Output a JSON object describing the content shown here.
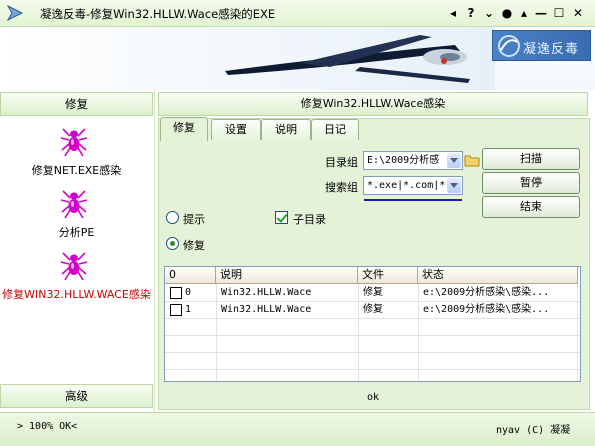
{
  "window": {
    "title": "凝逸反毒-修复Win32.HLLW.Wace感染的EXE",
    "controls": [
      "◂",
      "?",
      "⌄",
      "●",
      "▴",
      "—",
      "☐",
      "✕"
    ]
  },
  "banner": {
    "logo_text": "凝逸反毒"
  },
  "sidebar": {
    "header": "修复",
    "items": [
      {
        "label": "修复NET.EXE感染",
        "color": "#000000"
      },
      {
        "label": "分析PE",
        "color": "#000000"
      },
      {
        "label": "修复WIN32.HLLW.WACE感染",
        "color": "#cc0000"
      }
    ],
    "footer": "高级"
  },
  "main": {
    "header": "修复Win32.HLLW.Wace感染",
    "tabs": [
      "修复",
      "设置",
      "说明",
      "日记"
    ],
    "active_tab": "修复",
    "dir_label": "目录组",
    "dir_value": "E:\\2009分析感",
    "search_label": "搜索组",
    "search_value": "*.exe|*.com|*",
    "buttons": {
      "scan": "扫描",
      "pause": "暂停",
      "stop": "结束"
    },
    "options": {
      "prompt": "提示",
      "subdir": "子目录",
      "repair": "修复",
      "prompt_checked": false,
      "repair_checked": true,
      "subdir_checked": true
    },
    "table": {
      "columns": [
        "0",
        "说明",
        "文件",
        "状态"
      ],
      "rows": [
        {
          "id": "0",
          "desc": "Win32.HLLW.Wace",
          "file": "修复",
          "status": "e:\\2009分析感染\\感染..."
        },
        {
          "id": "1",
          "desc": "Win32.HLLW.Wace",
          "file": "修复",
          "status": "e:\\2009分析感染\\感染..."
        }
      ]
    },
    "status_text": "ok"
  },
  "statusbar": {
    "left": "> 100% OK<",
    "right": "nyav (C) 凝凝"
  },
  "colors": {
    "accent_green": "#dcf0cc",
    "highlight_red": "#cc0000",
    "spider_magenta": "#d000c8"
  }
}
